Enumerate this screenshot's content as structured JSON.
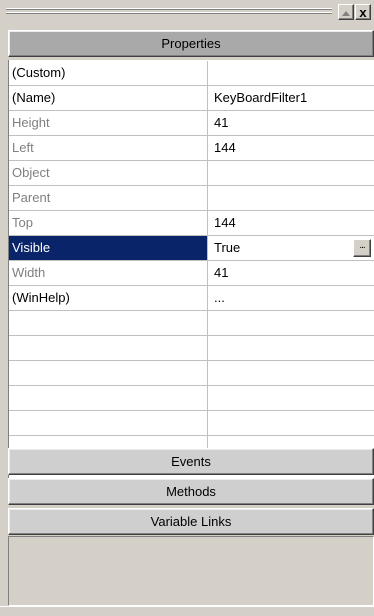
{
  "window": {
    "maximize_icon": "maximize-triangle-icon",
    "close_label": "x"
  },
  "sections": {
    "properties": "Properties",
    "events": "Events",
    "methods": "Methods",
    "variable_links": "Variable Links"
  },
  "properties": [
    {
      "name": "(Custom)",
      "value": "",
      "disabled": false,
      "selected": false
    },
    {
      "name": "(Name)",
      "value": "KeyBoardFilter1",
      "disabled": false,
      "selected": false
    },
    {
      "name": "Height",
      "value": "41",
      "disabled": true,
      "selected": false
    },
    {
      "name": "Left",
      "value": "144",
      "disabled": true,
      "selected": false
    },
    {
      "name": "Object",
      "value": "",
      "disabled": true,
      "selected": false
    },
    {
      "name": "Parent",
      "value": "",
      "disabled": true,
      "selected": false
    },
    {
      "name": "Top",
      "value": "144",
      "disabled": true,
      "selected": false
    },
    {
      "name": "Visible",
      "value": "True",
      "disabled": false,
      "selected": true,
      "button": "..."
    },
    {
      "name": "Width",
      "value": "41",
      "disabled": true,
      "selected": false
    },
    {
      "name": "(WinHelp)",
      "value": "...",
      "disabled": false,
      "selected": false
    }
  ],
  "colors": {
    "selection": "#0a246a",
    "face": "#d4d0c8",
    "header_active": "#a9a9a9"
  }
}
